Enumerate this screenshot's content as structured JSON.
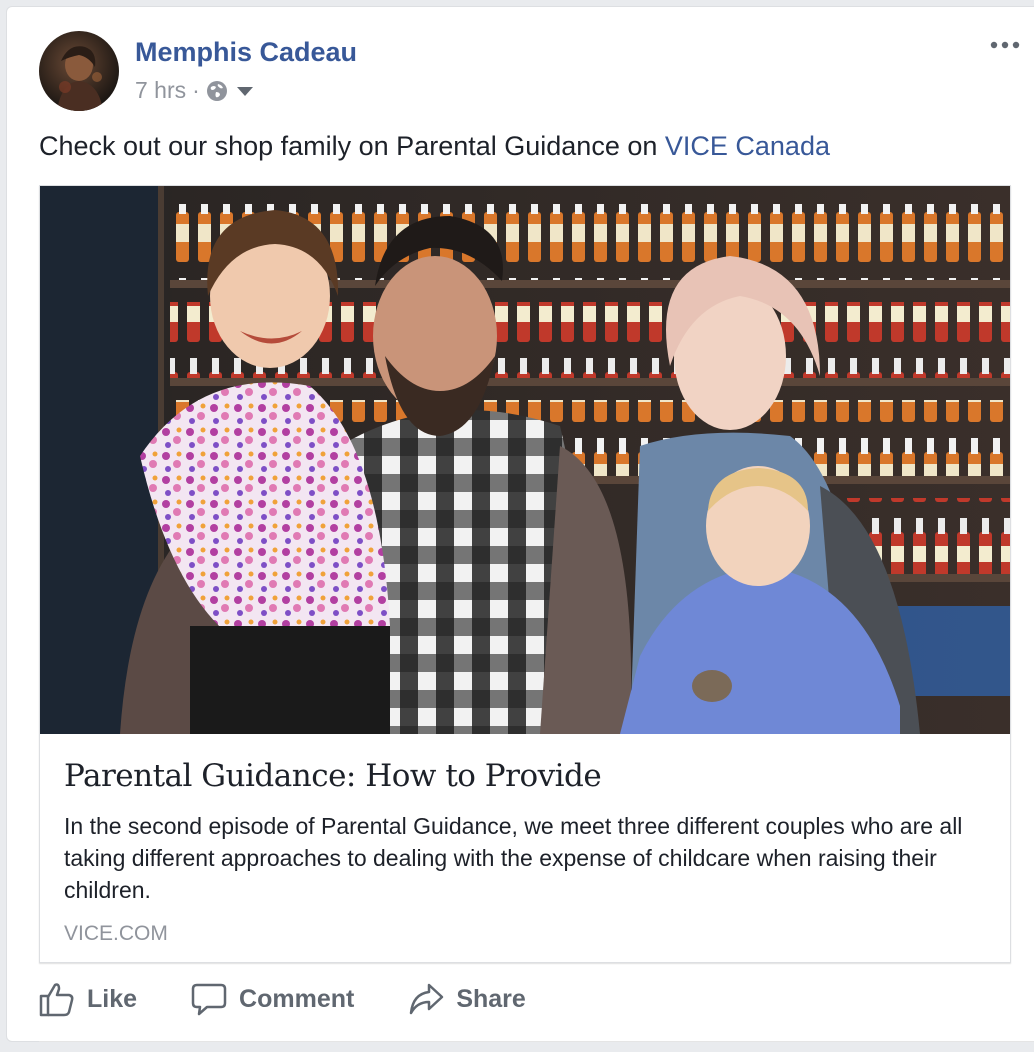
{
  "post": {
    "author": "Memphis Cadeau",
    "time": "7 hrs",
    "separator": "·",
    "privacy_icon": "globe-icon",
    "menu_icon": "ellipsis-icon",
    "text_prefix": "Check out our shop family on Parental Guidance on ",
    "text_link": "VICE Canada"
  },
  "share": {
    "title": "Parental Guidance: How to Provide",
    "description": "In the second episode of Parental Guidance, we meet three different couples who are all taking different approaches to dealing with the expense of childcare when raising their children.",
    "domain": "VICE.COM"
  },
  "actions": {
    "like": "Like",
    "comment": "Comment",
    "share": "Share"
  },
  "colors": {
    "brand_link": "#385898",
    "muted": "#90949c",
    "action_text": "#606770",
    "text": "#1d2129"
  }
}
